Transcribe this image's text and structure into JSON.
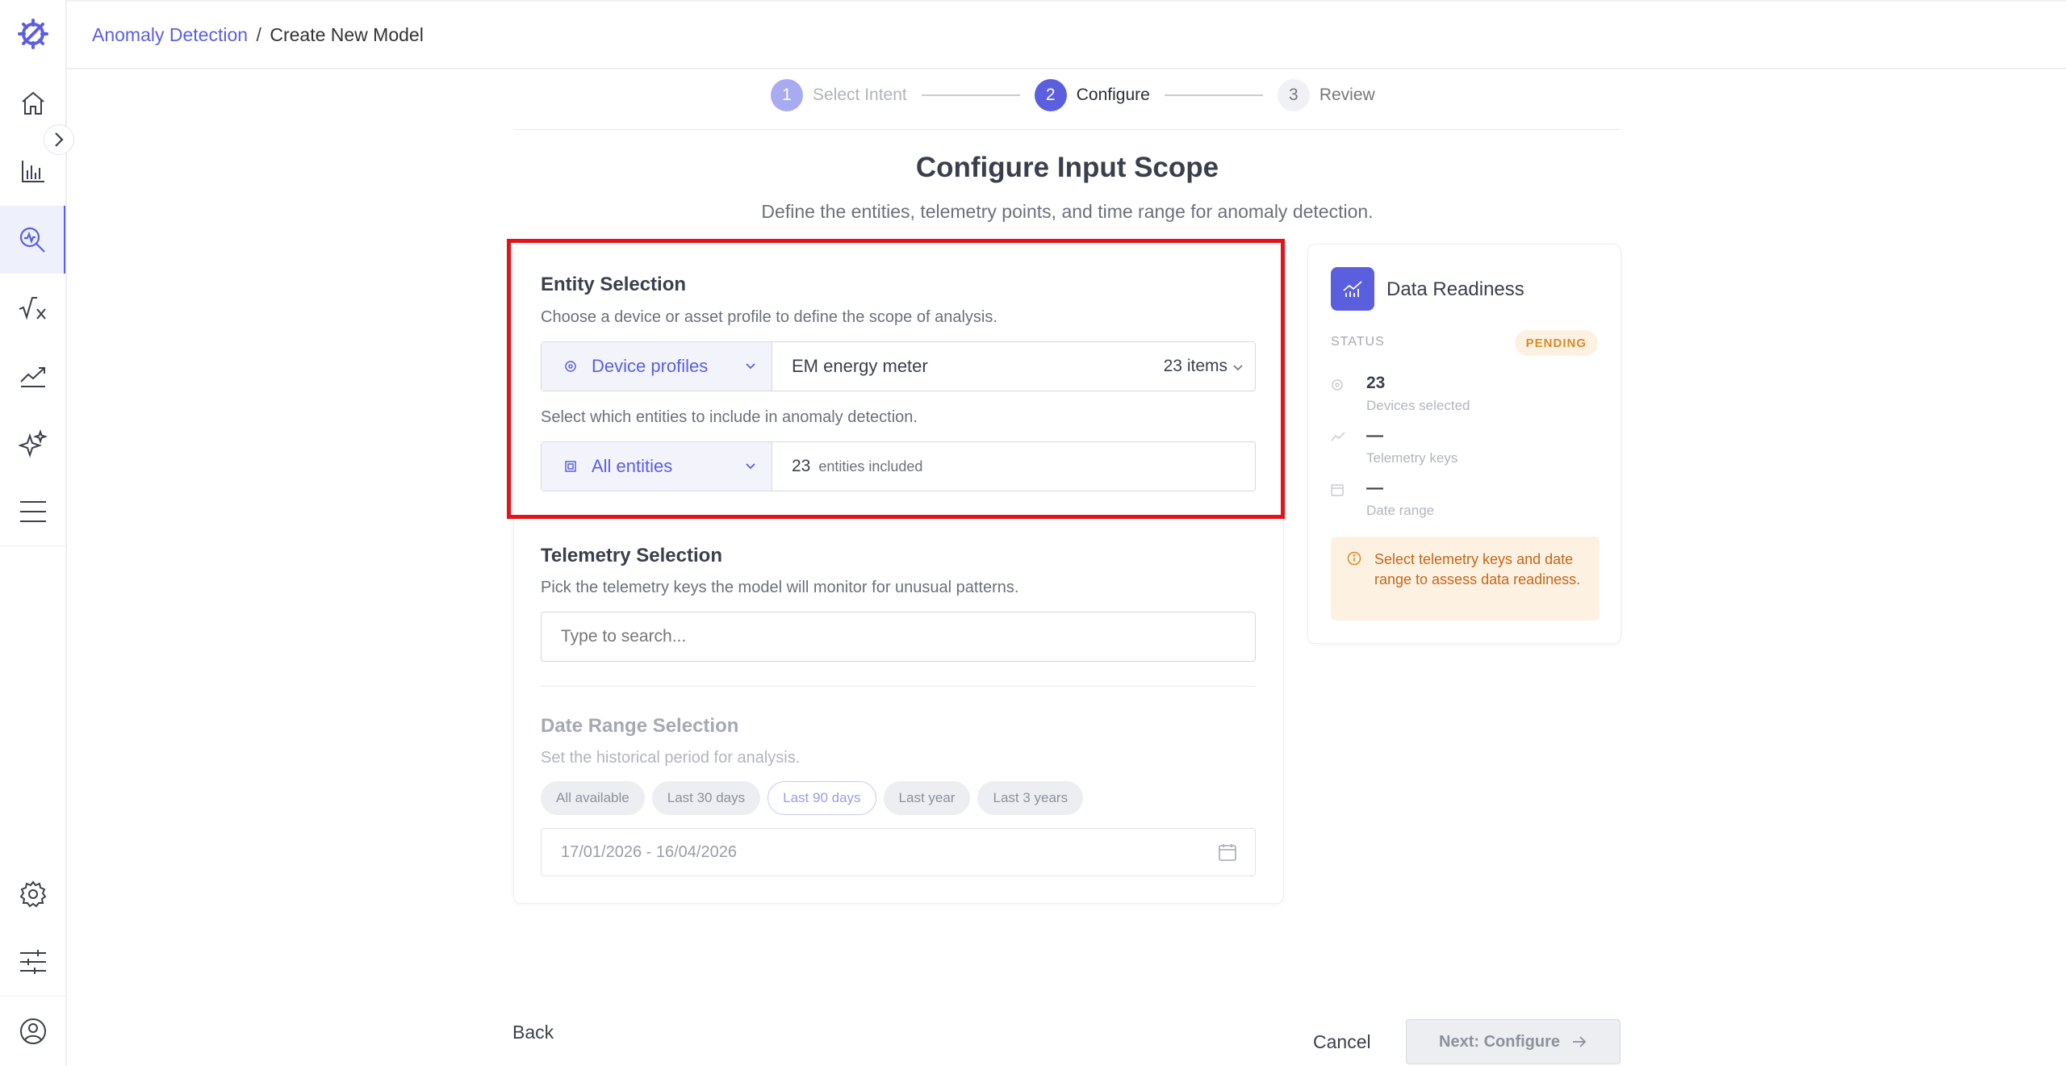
{
  "breadcrumb": {
    "parent": "Anomaly Detection",
    "separator": "/",
    "current": "Create New Model"
  },
  "stepper": {
    "steps": [
      {
        "number": "1",
        "label": "Select Intent",
        "state": "done"
      },
      {
        "number": "2",
        "label": "Configure",
        "state": "active"
      },
      {
        "number": "3",
        "label": "Review",
        "state": "pending"
      }
    ]
  },
  "page": {
    "title": "Configure Input Scope",
    "subtitle": "Define the entities, telemetry points, and time range for anomaly detection."
  },
  "entity_selection": {
    "title": "Entity Selection",
    "description": "Choose a device or asset profile to define the scope of analysis.",
    "profile_type": "Device profiles",
    "profile_value": "EM energy meter",
    "profile_count": "23 items",
    "filter_description": "Select which entities to include in anomaly detection.",
    "filter_type": "All entities",
    "entities_count": "23",
    "entities_label": "entities included"
  },
  "telemetry_selection": {
    "title": "Telemetry Selection",
    "description": "Pick the telemetry keys the model will monitor for unusual patterns.",
    "search_placeholder": "Type to search..."
  },
  "date_range": {
    "title": "Date Range Selection",
    "description": "Set the historical period for analysis.",
    "options": [
      "All available",
      "Last 30 days",
      "Last 90 days",
      "Last year",
      "Last 3 years"
    ],
    "selected": "Last 90 days",
    "value": "17/01/2026 - 16/04/2026"
  },
  "data_readiness": {
    "title": "Data Readiness",
    "status_label": "STATUS",
    "status": "PENDING",
    "devices_value": "23",
    "devices_label": "Devices selected",
    "telemetry_value": "—",
    "telemetry_label": "Telemetry keys",
    "date_value": "—",
    "date_label": "Date range",
    "notice": "Select telemetry keys and date range to assess data readiness."
  },
  "footer": {
    "back": "Back",
    "cancel": "Cancel",
    "next": "Next: Configure"
  },
  "colors": {
    "accent": "#5b5fde",
    "highlight": "#e2131b",
    "pending": "#d98a27"
  },
  "icons": [
    "logo-icon",
    "home-icon",
    "bar-chart-icon",
    "anomaly-search-icon",
    "formula-icon",
    "trend-icon",
    "sparkle-icon",
    "menu-icon",
    "settings-icon",
    "sliders-icon",
    "user-icon"
  ]
}
